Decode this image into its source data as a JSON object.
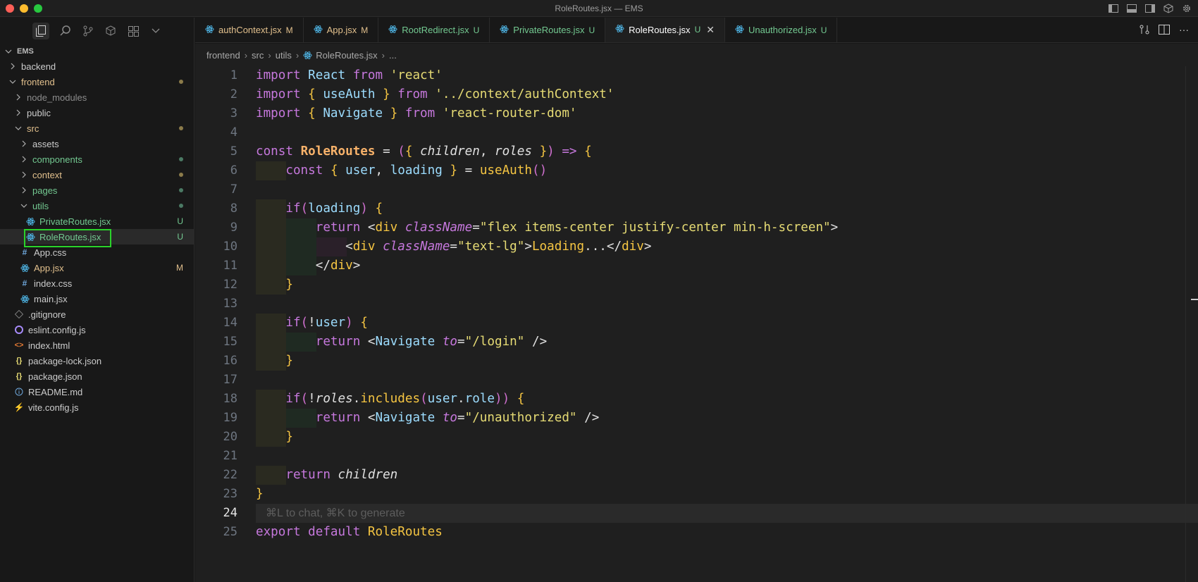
{
  "window": {
    "title": "RoleRoutes.jsx — EMS"
  },
  "sidebar": {
    "root": "EMS",
    "tree": [
      {
        "label": "backend",
        "type": "folder",
        "depth": 1,
        "open": false,
        "color": "#cccccc"
      },
      {
        "label": "frontend",
        "type": "folder",
        "depth": 1,
        "open": true,
        "color": "#e2c08d",
        "dot": "#8b7b4a"
      },
      {
        "label": "node_modules",
        "type": "folder",
        "depth": 2,
        "open": false,
        "color": "#8c8c8c"
      },
      {
        "label": "public",
        "type": "folder",
        "depth": 2,
        "open": false,
        "color": "#cccccc"
      },
      {
        "label": "src",
        "type": "folder",
        "depth": 2,
        "open": true,
        "color": "#e2c08d",
        "dot": "#8b7b4a"
      },
      {
        "label": "assets",
        "type": "folder",
        "depth": 3,
        "open": false,
        "color": "#cccccc"
      },
      {
        "label": "components",
        "type": "folder",
        "depth": 3,
        "open": false,
        "color": "#73c991",
        "dot": "#4b7a64"
      },
      {
        "label": "context",
        "type": "folder",
        "depth": 3,
        "open": false,
        "color": "#e2c08d",
        "dot": "#8b7b4a"
      },
      {
        "label": "pages",
        "type": "folder",
        "depth": 3,
        "open": false,
        "color": "#73c991",
        "dot": "#4b7a64"
      },
      {
        "label": "utils",
        "type": "folder",
        "depth": 3,
        "open": true,
        "color": "#73c991",
        "dot": "#4b7a64"
      },
      {
        "label": "PrivateRoutes.jsx",
        "type": "react",
        "depth": 4,
        "color": "#73c991",
        "badge": "U"
      },
      {
        "label": "RoleRoutes.jsx",
        "type": "react",
        "depth": 4,
        "color": "#73c991",
        "badge": "U",
        "selected": true
      },
      {
        "label": "App.css",
        "type": "css",
        "depth": 3,
        "color": "#cccccc"
      },
      {
        "label": "App.jsx",
        "type": "react",
        "depth": 3,
        "color": "#e2c08d",
        "badge": "M"
      },
      {
        "label": "index.css",
        "type": "css",
        "depth": 3,
        "color": "#cccccc"
      },
      {
        "label": "main.jsx",
        "type": "react",
        "depth": 3,
        "color": "#cccccc"
      },
      {
        "label": ".gitignore",
        "type": "git",
        "depth": 2,
        "color": "#cccccc"
      },
      {
        "label": "eslint.config.js",
        "type": "eslint",
        "depth": 2,
        "color": "#cccccc"
      },
      {
        "label": "index.html",
        "type": "html",
        "depth": 2,
        "color": "#cccccc"
      },
      {
        "label": "package-lock.json",
        "type": "json",
        "depth": 2,
        "color": "#cccccc"
      },
      {
        "label": "package.json",
        "type": "json",
        "depth": 2,
        "color": "#cccccc"
      },
      {
        "label": "README.md",
        "type": "info",
        "depth": 2,
        "color": "#cccccc"
      },
      {
        "label": "vite.config.js",
        "type": "vite",
        "depth": 2,
        "color": "#cccccc"
      }
    ]
  },
  "tabs": [
    {
      "label": "authContext.jsx",
      "status": "M",
      "color": "#e2c08d"
    },
    {
      "label": "App.jsx",
      "status": "M",
      "color": "#e2c08d"
    },
    {
      "label": "RootRedirect.jsx",
      "status": "U",
      "color": "#73c991"
    },
    {
      "label": "PrivateRoutes.jsx",
      "status": "U",
      "color": "#73c991"
    },
    {
      "label": "RoleRoutes.jsx",
      "status": "U",
      "color": "#73c991",
      "active": true
    },
    {
      "label": "Unauthorized.jsx",
      "status": "U",
      "color": "#73c991"
    }
  ],
  "breadcrumb": [
    "frontend",
    "src",
    "utils",
    "RoleRoutes.jsx",
    "..."
  ],
  "editor": {
    "current_line": 24,
    "ghost_hint": "⌘L to chat, ⌘K to generate",
    "lines": [
      "import React from 'react'",
      "import { useAuth } from '../context/authContext'",
      "import { Navigate } from 'react-router-dom'",
      "",
      "const RoleRoutes = ({ children, roles }) => {",
      "    const { user, loading } = useAuth()",
      "",
      "    if(loading) {",
      "        return <div className=\"flex items-center justify-center min-h-screen\">",
      "            <div className=\"text-lg\">Loading...</div>",
      "        </div>",
      "    }",
      "",
      "    if(!user) {",
      "        return <Navigate to=\"/login\" />",
      "    }",
      "",
      "    if(!roles.includes(user.role)) {",
      "        return <Navigate to=\"/unauthorized\" />",
      "    }",
      "",
      "    return children",
      "}",
      "",
      "export default RoleRoutes"
    ]
  },
  "colors": {
    "accent_selected_outline": "#2ad22a",
    "modified": "#e2c08d",
    "untracked": "#73c991"
  }
}
